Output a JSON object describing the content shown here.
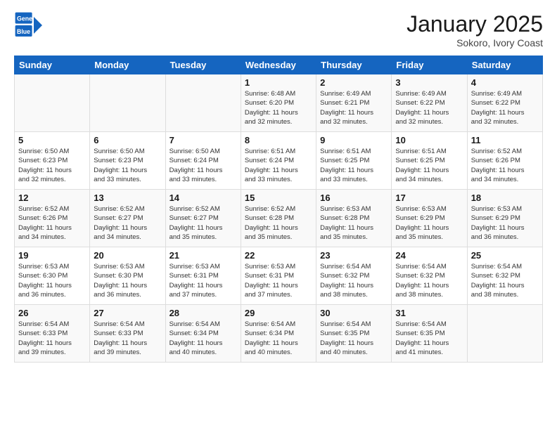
{
  "header": {
    "logo_line1": "General",
    "logo_line2": "Blue",
    "month": "January 2025",
    "location": "Sokoro, Ivory Coast"
  },
  "days_header": [
    "Sunday",
    "Monday",
    "Tuesday",
    "Wednesday",
    "Thursday",
    "Friday",
    "Saturday"
  ],
  "weeks": [
    [
      {
        "day": "",
        "info": ""
      },
      {
        "day": "",
        "info": ""
      },
      {
        "day": "",
        "info": ""
      },
      {
        "day": "1",
        "info": "Sunrise: 6:48 AM\nSunset: 6:20 PM\nDaylight: 11 hours\nand 32 minutes."
      },
      {
        "day": "2",
        "info": "Sunrise: 6:49 AM\nSunset: 6:21 PM\nDaylight: 11 hours\nand 32 minutes."
      },
      {
        "day": "3",
        "info": "Sunrise: 6:49 AM\nSunset: 6:22 PM\nDaylight: 11 hours\nand 32 minutes."
      },
      {
        "day": "4",
        "info": "Sunrise: 6:49 AM\nSunset: 6:22 PM\nDaylight: 11 hours\nand 32 minutes."
      }
    ],
    [
      {
        "day": "5",
        "info": "Sunrise: 6:50 AM\nSunset: 6:23 PM\nDaylight: 11 hours\nand 32 minutes."
      },
      {
        "day": "6",
        "info": "Sunrise: 6:50 AM\nSunset: 6:23 PM\nDaylight: 11 hours\nand 33 minutes."
      },
      {
        "day": "7",
        "info": "Sunrise: 6:50 AM\nSunset: 6:24 PM\nDaylight: 11 hours\nand 33 minutes."
      },
      {
        "day": "8",
        "info": "Sunrise: 6:51 AM\nSunset: 6:24 PM\nDaylight: 11 hours\nand 33 minutes."
      },
      {
        "day": "9",
        "info": "Sunrise: 6:51 AM\nSunset: 6:25 PM\nDaylight: 11 hours\nand 33 minutes."
      },
      {
        "day": "10",
        "info": "Sunrise: 6:51 AM\nSunset: 6:25 PM\nDaylight: 11 hours\nand 34 minutes."
      },
      {
        "day": "11",
        "info": "Sunrise: 6:52 AM\nSunset: 6:26 PM\nDaylight: 11 hours\nand 34 minutes."
      }
    ],
    [
      {
        "day": "12",
        "info": "Sunrise: 6:52 AM\nSunset: 6:26 PM\nDaylight: 11 hours\nand 34 minutes."
      },
      {
        "day": "13",
        "info": "Sunrise: 6:52 AM\nSunset: 6:27 PM\nDaylight: 11 hours\nand 34 minutes."
      },
      {
        "day": "14",
        "info": "Sunrise: 6:52 AM\nSunset: 6:27 PM\nDaylight: 11 hours\nand 35 minutes."
      },
      {
        "day": "15",
        "info": "Sunrise: 6:52 AM\nSunset: 6:28 PM\nDaylight: 11 hours\nand 35 minutes."
      },
      {
        "day": "16",
        "info": "Sunrise: 6:53 AM\nSunset: 6:28 PM\nDaylight: 11 hours\nand 35 minutes."
      },
      {
        "day": "17",
        "info": "Sunrise: 6:53 AM\nSunset: 6:29 PM\nDaylight: 11 hours\nand 35 minutes."
      },
      {
        "day": "18",
        "info": "Sunrise: 6:53 AM\nSunset: 6:29 PM\nDaylight: 11 hours\nand 36 minutes."
      }
    ],
    [
      {
        "day": "19",
        "info": "Sunrise: 6:53 AM\nSunset: 6:30 PM\nDaylight: 11 hours\nand 36 minutes."
      },
      {
        "day": "20",
        "info": "Sunrise: 6:53 AM\nSunset: 6:30 PM\nDaylight: 11 hours\nand 36 minutes."
      },
      {
        "day": "21",
        "info": "Sunrise: 6:53 AM\nSunset: 6:31 PM\nDaylight: 11 hours\nand 37 minutes."
      },
      {
        "day": "22",
        "info": "Sunrise: 6:53 AM\nSunset: 6:31 PM\nDaylight: 11 hours\nand 37 minutes."
      },
      {
        "day": "23",
        "info": "Sunrise: 6:54 AM\nSunset: 6:32 PM\nDaylight: 11 hours\nand 38 minutes."
      },
      {
        "day": "24",
        "info": "Sunrise: 6:54 AM\nSunset: 6:32 PM\nDaylight: 11 hours\nand 38 minutes."
      },
      {
        "day": "25",
        "info": "Sunrise: 6:54 AM\nSunset: 6:32 PM\nDaylight: 11 hours\nand 38 minutes."
      }
    ],
    [
      {
        "day": "26",
        "info": "Sunrise: 6:54 AM\nSunset: 6:33 PM\nDaylight: 11 hours\nand 39 minutes."
      },
      {
        "day": "27",
        "info": "Sunrise: 6:54 AM\nSunset: 6:33 PM\nDaylight: 11 hours\nand 39 minutes."
      },
      {
        "day": "28",
        "info": "Sunrise: 6:54 AM\nSunset: 6:34 PM\nDaylight: 11 hours\nand 40 minutes."
      },
      {
        "day": "29",
        "info": "Sunrise: 6:54 AM\nSunset: 6:34 PM\nDaylight: 11 hours\nand 40 minutes."
      },
      {
        "day": "30",
        "info": "Sunrise: 6:54 AM\nSunset: 6:35 PM\nDaylight: 11 hours\nand 40 minutes."
      },
      {
        "day": "31",
        "info": "Sunrise: 6:54 AM\nSunset: 6:35 PM\nDaylight: 11 hours\nand 41 minutes."
      },
      {
        "day": "",
        "info": ""
      }
    ]
  ]
}
